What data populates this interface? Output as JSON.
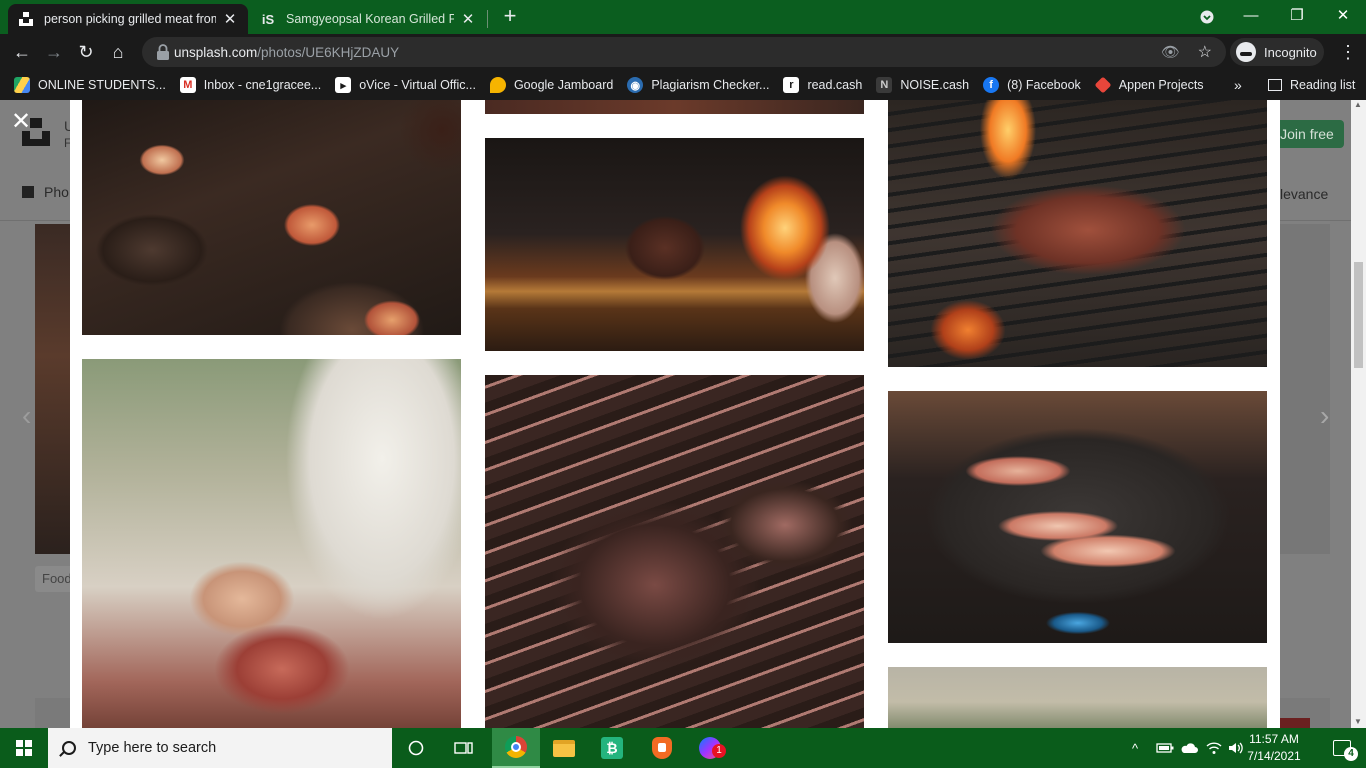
{
  "browser": {
    "tabs": [
      {
        "title": "person picking grilled meat from",
        "favicon": "unsplash-icon",
        "active": true
      },
      {
        "title": "Samgyeopsal Korean Grilled Pork",
        "favicon": "iS",
        "active": false
      }
    ],
    "url_host": "unsplash.com",
    "url_path": "/photos/UE6KHjZDAUY",
    "profile_label": "Incognito",
    "bookmarks": [
      {
        "label": "ONLINE STUDENTS...",
        "icon": "drive-icon",
        "color": "#1fa463"
      },
      {
        "label": "Inbox - cne1gracee...",
        "icon": "gmail-icon",
        "color": "#d93025"
      },
      {
        "label": "oVice - Virtual Offic...",
        "icon": "ovice-icon",
        "color": "#ffffff"
      },
      {
        "label": "Google Jamboard",
        "icon": "jamboard-icon",
        "color": "#f6b400"
      },
      {
        "label": "Plagiarism Checker...",
        "icon": "plagiarism-icon",
        "color": "#2b6cb0"
      },
      {
        "label": "read.cash",
        "icon": "readcash-icon",
        "color": "#ffffff"
      },
      {
        "label": "NOISE.cash",
        "icon": "noisecash-icon",
        "color": "#888888"
      },
      {
        "label": "(8) Facebook",
        "icon": "facebook-icon",
        "color": "#1877f2"
      },
      {
        "label": "Appen Projects",
        "icon": "appen-icon",
        "color": "#e8463b"
      }
    ],
    "bookmarks_overflow": "»",
    "reading_list": "Reading list"
  },
  "background_page": {
    "header_initial": "U",
    "header_sub": "F",
    "join_label": "Join free",
    "photos_tab": "Pho",
    "sort_label": "levance",
    "tag_label": "Food"
  },
  "taskbar": {
    "search_placeholder": "Type here to search",
    "time": "11:57 AM",
    "date": "7/14/2021",
    "notification_count": "4",
    "messenger_badge": "1"
  }
}
